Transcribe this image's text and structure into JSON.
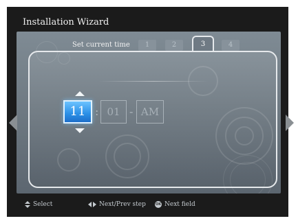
{
  "wizard": {
    "title": "Installation Wizard"
  },
  "steps": {
    "label": "Set current time",
    "tabs": [
      {
        "label": "1",
        "active": false
      },
      {
        "label": "2",
        "active": false
      },
      {
        "label": "3",
        "active": true
      },
      {
        "label": "4",
        "active": false
      }
    ]
  },
  "time": {
    "hour": "11",
    "separator_colon": ":",
    "minute": "01",
    "separator_dash": "-",
    "meridiem": "AM"
  },
  "footer": {
    "select_label": "Select",
    "step_label": "Next/Prev step",
    "field_label": "Next field",
    "ok_icon_text": "OK"
  },
  "icons": {
    "nav_left": "triangle-left-icon",
    "nav_right": "triangle-right-icon",
    "spin_up": "triangle-up-icon",
    "spin_down": "triangle-down-icon"
  },
  "colors": {
    "selected_field": "#2a8fe6",
    "background": "#1b1b1b",
    "panel_border": "#e6e9ec"
  }
}
